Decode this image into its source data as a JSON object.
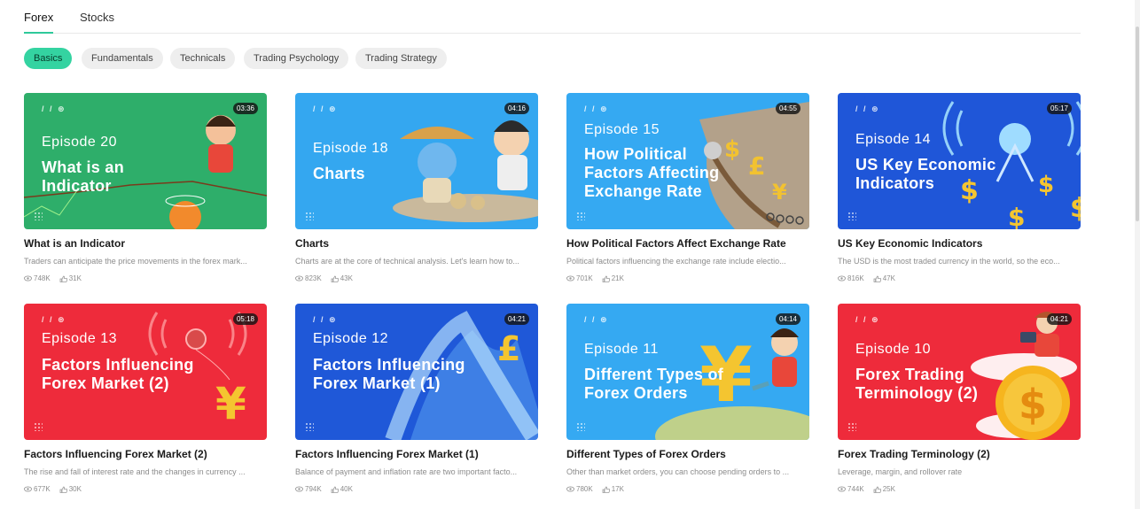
{
  "tabs": [
    {
      "label": "Forex",
      "active": true
    },
    {
      "label": "Stocks",
      "active": false
    }
  ],
  "chips": [
    {
      "label": "Basics",
      "active": true
    },
    {
      "label": "Fundamentals",
      "active": false
    },
    {
      "label": "Technicals",
      "active": false
    },
    {
      "label": "Trading Psychology",
      "active": false
    },
    {
      "label": "Trading Strategy",
      "active": false
    }
  ],
  "cards": [
    {
      "episode": "Episode 20",
      "thumb_title": "What is an Indicator",
      "duration": "03:36",
      "title": "What is an Indicator",
      "desc": "Traders can anticipate the price movements in the forex mark...",
      "views": "748K",
      "likes": "31K",
      "color": "#2eae6a"
    },
    {
      "episode": "Episode 18",
      "thumb_title": "Charts",
      "duration": "04:16",
      "title": "Charts",
      "desc": "Charts are at the core of technical analysis. Let's learn how to...",
      "views": "823K",
      "likes": "43K",
      "color": "#34a7f0"
    },
    {
      "episode": "Episode 15",
      "thumb_title": "How Political Factors Affecting Exchange Rate",
      "duration": "04:55",
      "title": "How Political Factors Affect Exchange Rate",
      "desc": "Political factors influencing the exchange rate include electio...",
      "views": "701K",
      "likes": "21K",
      "color": "#35a9f2"
    },
    {
      "episode": "Episode 14",
      "thumb_title": "US Key Economic Indicators",
      "duration": "05:17",
      "title": "US Key Economic Indicators",
      "desc": "The USD is the most traded currency in the world, so the eco...",
      "views": "816K",
      "likes": "47K",
      "color": "#1f56d8"
    },
    {
      "episode": "Episode 13",
      "thumb_title": "Factors Influencing Forex Market (2)",
      "duration": "05:18",
      "title": "Factors Influencing Forex Market (2)",
      "desc": "The rise and fall of interest rate and the changes in currency ...",
      "views": "677K",
      "likes": "30K",
      "color": "#ee2b3b"
    },
    {
      "episode": "Episode 12",
      "thumb_title": "Factors Influencing Forex Market (1)",
      "duration": "04:21",
      "title": "Factors Influencing Forex Market (1)",
      "desc": "Balance of payment and inflation rate are two important facto...",
      "views": "794K",
      "likes": "40K",
      "color": "#1f58d8"
    },
    {
      "episode": "Episode 11",
      "thumb_title": "Different Types of Forex Orders",
      "duration": "04:14",
      "title": "Different Types of Forex Orders",
      "desc": "Other than market orders, you can choose pending orders to ...",
      "views": "780K",
      "likes": "17K",
      "color": "#35a9f2"
    },
    {
      "episode": "Episode 10",
      "thumb_title": "Forex Trading Terminology (2)",
      "duration": "04:21",
      "title": "Forex Trading Terminology (2)",
      "desc": "Leverage, margin, and rollover rate",
      "views": "744K",
      "likes": "25K",
      "color": "#ee2b3b"
    }
  ]
}
